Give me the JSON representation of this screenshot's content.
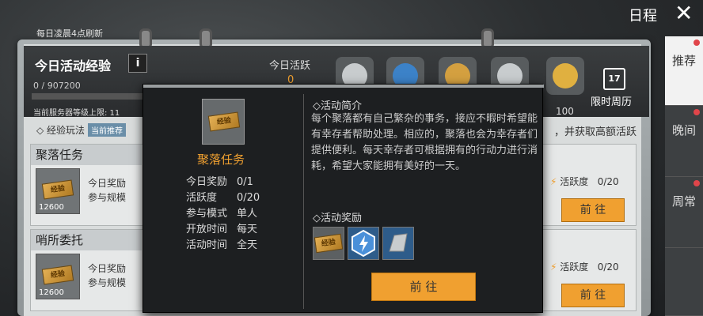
{
  "header": {
    "refresh_note": "每日凌晨4点刷新",
    "title": "今日活动经验",
    "info_label": "i",
    "progress_text": "0 / 907200",
    "server_level": "当前服务器等级上限: 11",
    "today_active_label": "今日活跃",
    "today_active_value": "0",
    "max_active": "100",
    "calendar_label": "限时周历",
    "calendar_day": "17"
  },
  "topright": {
    "title": "日程",
    "close_label": "✕"
  },
  "side_tabs": [
    {
      "label": "推荐",
      "active": true
    },
    {
      "label": "晚间",
      "active": false
    },
    {
      "label": "周常",
      "active": false
    }
  ],
  "exp_section": {
    "label": "◇ 经验玩法",
    "tag": "当前推荐",
    "right_text": "，并获取高额活跃"
  },
  "cards": [
    {
      "title": "聚落任务",
      "reward_label": "今日奖励",
      "scale_label": "参与规模",
      "thumb_label": "经验",
      "thumb_number": "12600",
      "active_label": "活跃度",
      "active_value": "0/20",
      "go_label": "前 往"
    },
    {
      "title": "哨所委托",
      "reward_label": "今日奖励",
      "scale_label": "参与规模",
      "thumb_label": "经验",
      "thumb_number": "12600",
      "active_label": "活跃度",
      "active_value": "0/20",
      "go_label": "前 往"
    }
  ],
  "modal": {
    "name": "聚落任务",
    "icon_label": "经验",
    "stats": [
      {
        "label": "今日奖励",
        "value": "0/1"
      },
      {
        "label": "活跃度",
        "value": "0/20"
      },
      {
        "label": "参与模式",
        "value": "单人"
      },
      {
        "label": "开放时间",
        "value": "每天"
      },
      {
        "label": "活动时间",
        "value": "全天"
      }
    ],
    "intro_title": "◇活动简介",
    "intro_text": "每个聚落都有自己繁杂的事务，接应不暇时希望能有幸存者帮助处理。相应的，聚落也会为幸存者们提供便利。每天幸存者可根据拥有的行动力进行消耗，希望大家能拥有美好的一天。",
    "reward_title": "◇活动奖励",
    "reward_slot_label": "经验",
    "go_label": "前 往"
  }
}
